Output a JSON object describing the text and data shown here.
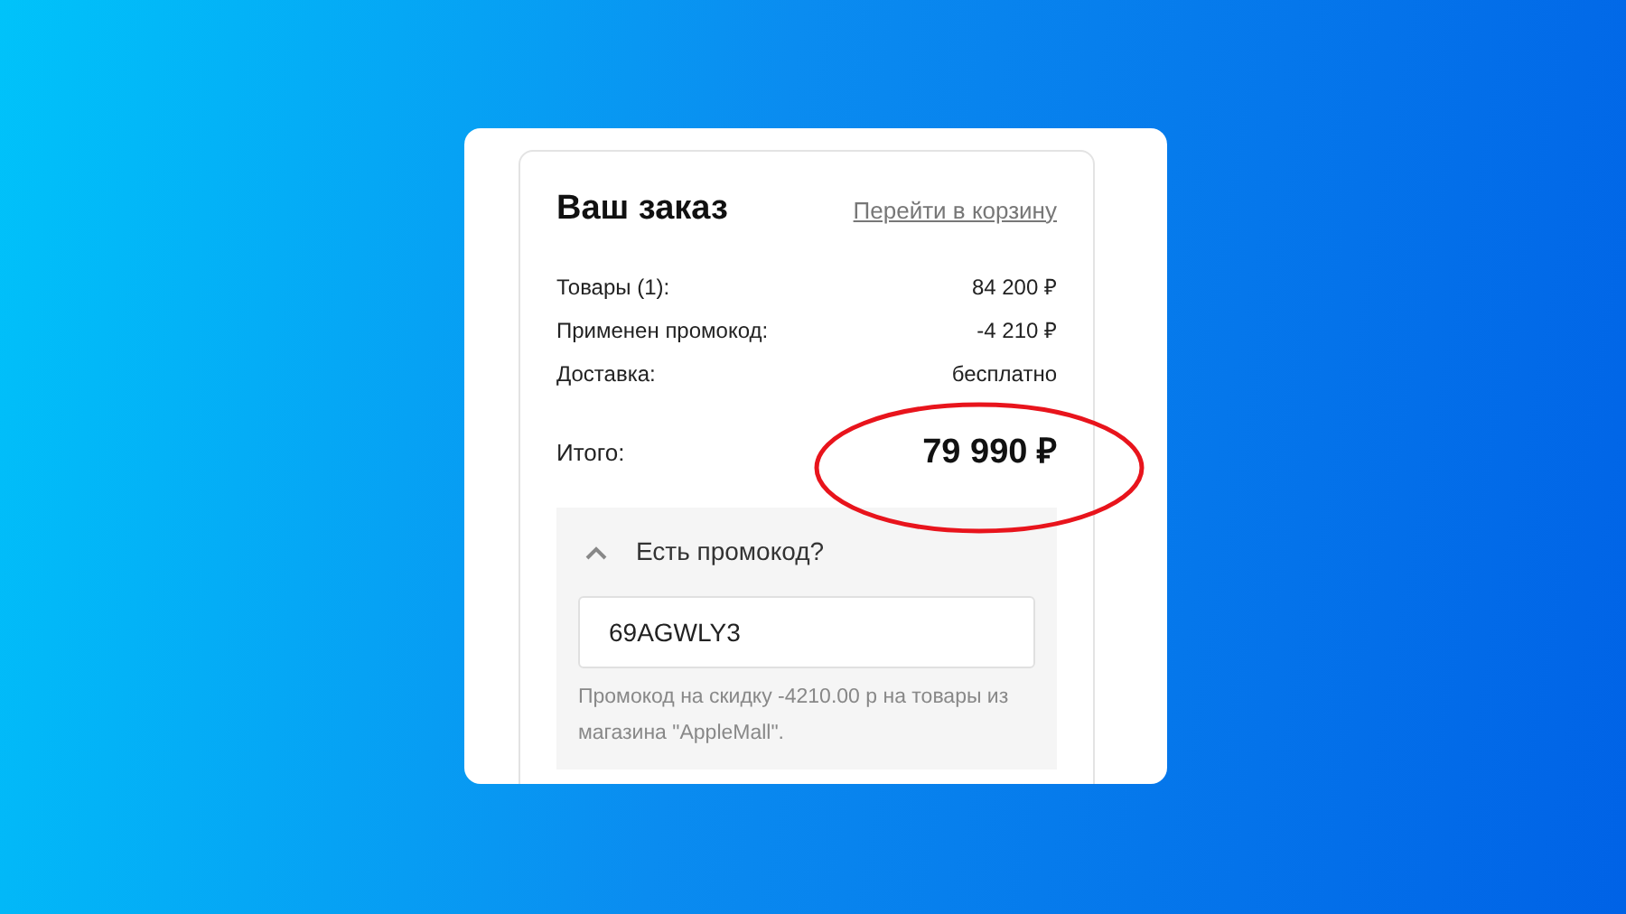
{
  "order": {
    "title": "Ваш заказ",
    "cart_link": "Перейти в корзину",
    "lines": [
      {
        "label": "Товары (1):",
        "value": "84 200 ₽"
      },
      {
        "label": "Применен промокод:",
        "value": "-4 210 ₽"
      },
      {
        "label": "Доставка:",
        "value": "бесплатно"
      }
    ],
    "total": {
      "label": "Итого:",
      "value": "79 990 ₽"
    },
    "promo": {
      "title": "Есть промокод?",
      "expanded": true,
      "value": "69AGWLY3",
      "note": "Промокод на скидку -4210.00 р на товары из магазина \"AppleMall\"."
    }
  },
  "annotations": [
    {
      "kind": "ellipse"
    }
  ]
}
